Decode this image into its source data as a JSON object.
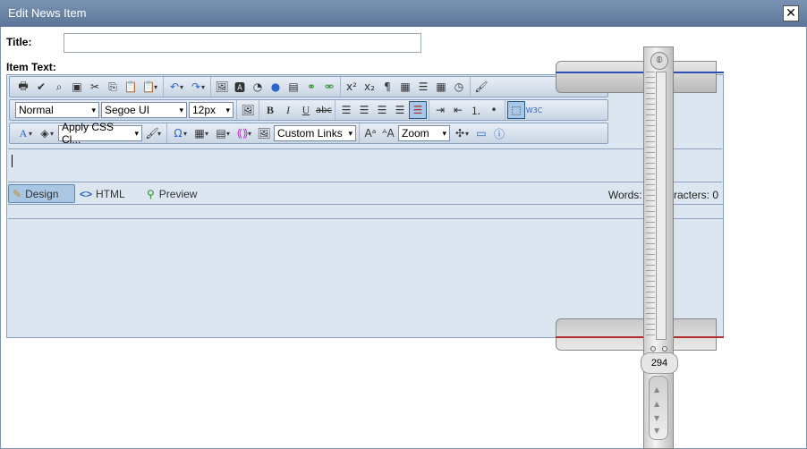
{
  "window": {
    "title": "Edit News Item",
    "close_label": "✕"
  },
  "form": {
    "title_label": "Title:",
    "title_value": "",
    "item_text_label": "Item Text:"
  },
  "toolbar": {
    "row1": [
      "print-icon",
      "spellcheck-icon",
      "find-replace-icon",
      "select-all-icon",
      "cut-icon",
      "copy-icon",
      "paste-icon",
      "paste-options-icon",
      "undo-icon",
      "redo-icon",
      "image-manager-icon",
      "flash-manager-icon",
      "media-manager-icon",
      "document-manager-icon",
      "template-manager-icon",
      "hyperlink-icon",
      "remove-link-icon",
      "superscript-icon",
      "subscript-icon",
      "paragraph-icon",
      "insert-date-icon",
      "insert-time-icon",
      "format-code-block-icon",
      "format-stripper-icon"
    ],
    "row2": {
      "paragraph_style": "Normal",
      "font_name": "Segoe UI",
      "font_size": "12px",
      "icons": [
        "image-map-icon",
        "bold-icon",
        "italic-icon",
        "underline-icon",
        "strikethrough-icon",
        "align-left-icon",
        "align-center-icon",
        "align-right-icon",
        "justify-icon",
        "remove-alignment-icon",
        "indent-icon",
        "outdent-icon",
        "numbered-list-icon",
        "bulleted-list-icon",
        "toggle-borders-icon",
        "xhtml-validator-icon"
      ]
    },
    "row3": {
      "css_class": "Apply CSS Cl...",
      "custom_links": "Custom Links",
      "zoom": "Zoom"
    }
  },
  "modes": {
    "design": "Design",
    "html": "HTML",
    "preview": "Preview"
  },
  "stats": {
    "words": "Words: 0",
    "characters": "Characters: 0"
  },
  "caliper": {
    "readout": "294"
  }
}
